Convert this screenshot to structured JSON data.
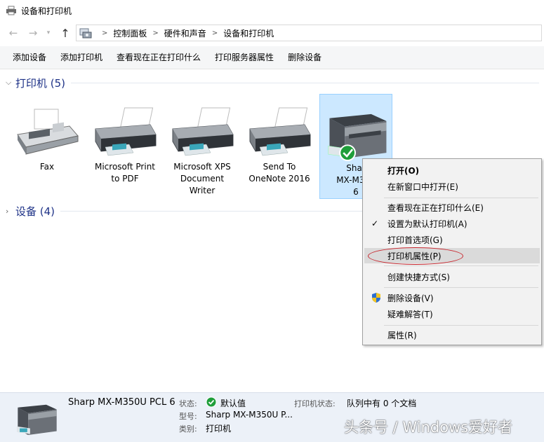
{
  "window": {
    "title": "设备和打印机"
  },
  "address": {
    "crumbs": [
      "控制面板",
      "硬件和声音",
      "设备和打印机"
    ]
  },
  "toolbar": {
    "add_device": "添加设备",
    "add_printer": "添加打印机",
    "see_printing": "查看现在正在打印什么",
    "print_server_props": "打印服务器属性",
    "remove_device": "删除设备"
  },
  "groups": {
    "printers": "打印机 (5)",
    "devices": "设备 (4)"
  },
  "devices": [
    {
      "label": "Fax"
    },
    {
      "label": "Microsoft Print to PDF"
    },
    {
      "label": "Microsoft XPS Document Writer"
    },
    {
      "label": "Send To OneNote 2016"
    },
    {
      "label": "Sharp MX-M350U PCL 6",
      "visible_label": "Shar MX-M350 6"
    }
  ],
  "context_menu": {
    "open": "打开(O)",
    "open_new_window": "在新窗口中打开(E)",
    "see_printing": "查看现在正在打印什么(E)",
    "set_default": "设置为默认打印机(A)",
    "preferences": "打印首选项(G)",
    "printer_props": "打印机属性(P)",
    "create_shortcut": "创建快捷方式(S)",
    "remove_device": "删除设备(V)",
    "troubleshoot": "疑难解答(T)",
    "properties": "属性(R)"
  },
  "details": {
    "name": "Sharp MX-M350U PCL 6",
    "status_key": "状态:",
    "status_value": "默认值",
    "model_key": "型号:",
    "model_value": "Sharp MX-M350U P...",
    "category_key": "类别:",
    "category_value": "打印机",
    "printer_status_key": "打印机状态:",
    "printer_status_value": "队列中有 0 个文档"
  },
  "watermark": "头条号 / Windows爱好者",
  "colors": {
    "group_title": "#1e3287",
    "selection_bg": "#cce8ff",
    "menu_highlight": "#dadada",
    "annotation_red": "#c8242c",
    "default_check": "#1f9e3a"
  }
}
